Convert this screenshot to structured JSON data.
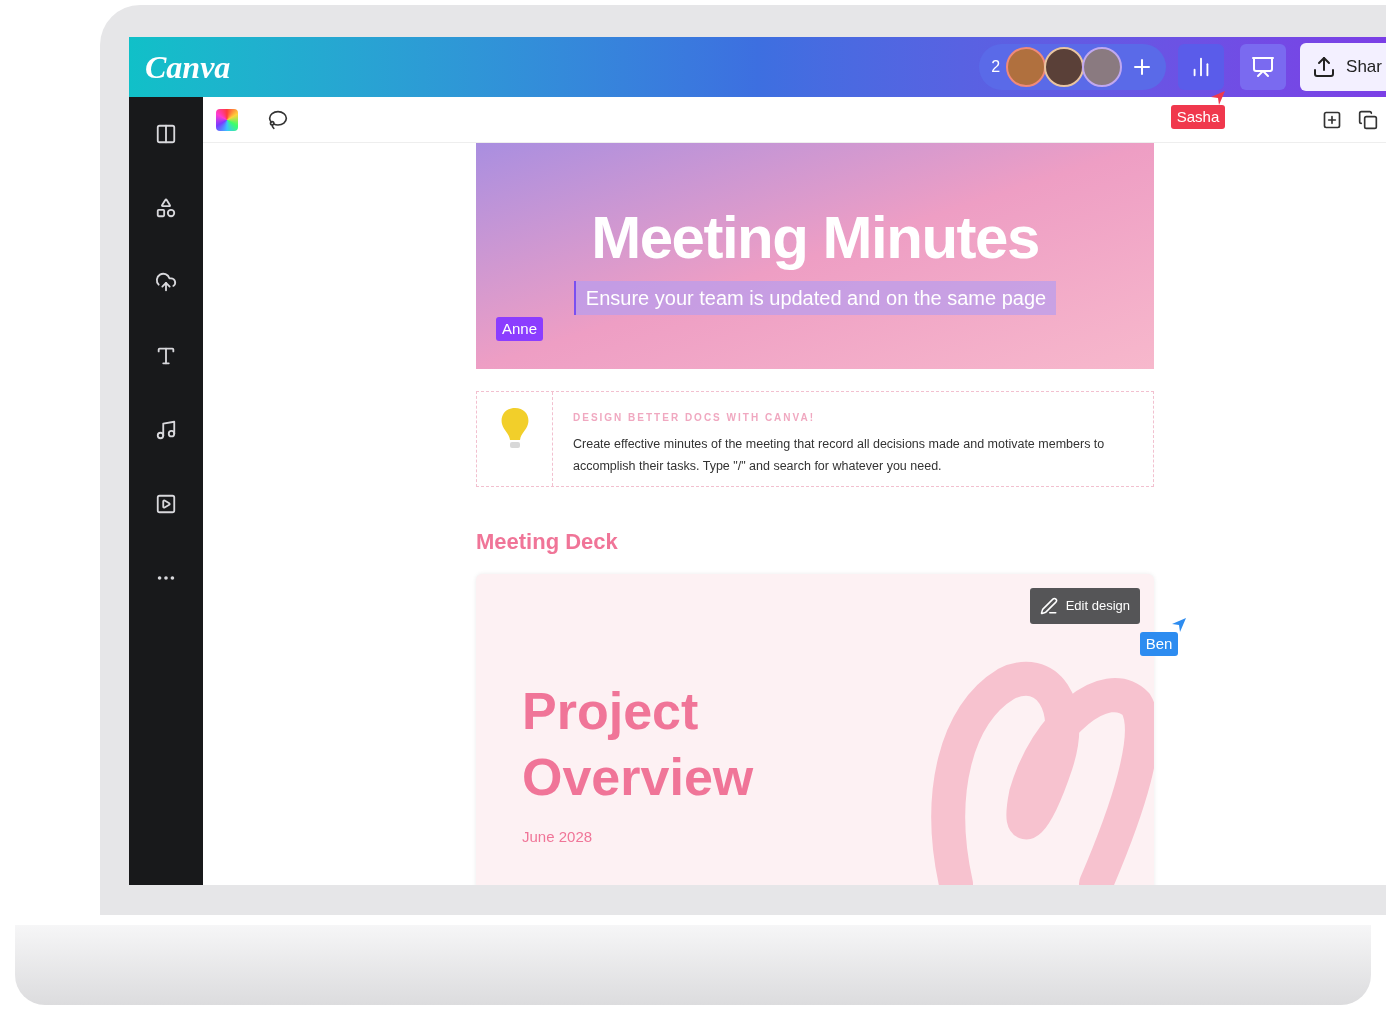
{
  "topbar": {
    "logo": "Canva",
    "collaborator_count": "2",
    "share_button": "Shar"
  },
  "cursors": [
    {
      "name": "Sasha",
      "color": "#f0384d"
    },
    {
      "name": "Anne",
      "color": "#8b3dff"
    },
    {
      "name": "Ben",
      "color": "#2d8cf0"
    }
  ],
  "header": {
    "title": "Meeting Minutes",
    "subtitle": "Ensure your team is updated and on the same page"
  },
  "tip": {
    "heading": "DESIGN BETTER DOCS WITH CANVA!",
    "body": "Create effective minutes of the meeting that record all decisions made and motivate members to accomplish their tasks. Type \"/\" and search for whatever you need."
  },
  "section_heading": "Meeting Deck",
  "deck": {
    "title_line_1": "Project",
    "title_line_2": "Overview",
    "date": "June 2028",
    "edit_button": "Edit design"
  }
}
